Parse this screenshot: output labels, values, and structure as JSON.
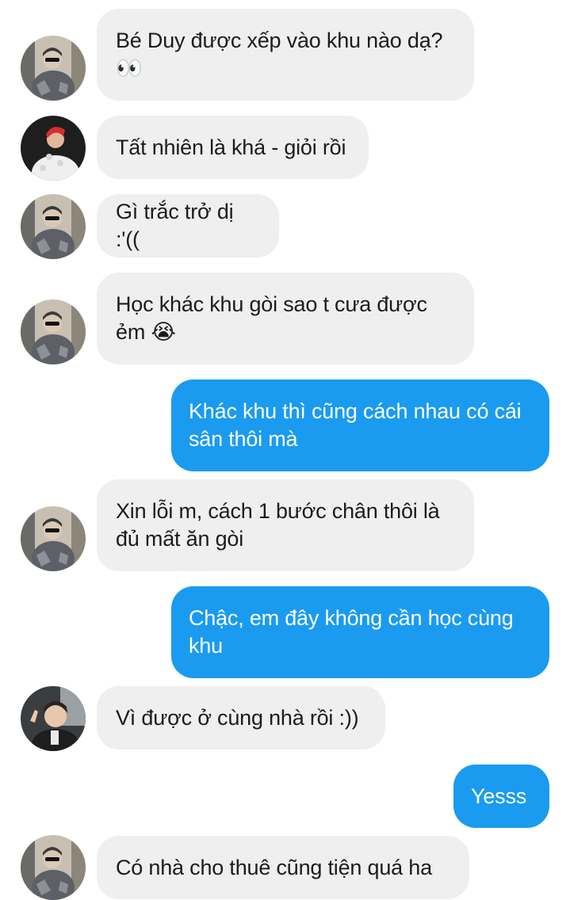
{
  "messages": [
    {
      "id": "m1",
      "side": "received",
      "avatar": "friend-a",
      "text": "Bé Duy được xếp vào khu nào dạ? 👀"
    },
    {
      "id": "m2",
      "side": "received",
      "avatar": "friend-b",
      "text": "Tất nhiên là khá - giỏi rồi"
    },
    {
      "id": "m3",
      "side": "received",
      "avatar": "friend-a",
      "text": "Gì trắc trở dị :'(("
    },
    {
      "id": "m4",
      "side": "received",
      "avatar": "friend-a",
      "text": "Học khác khu gòi sao t cưa được ẻm 😭"
    },
    {
      "id": "m5",
      "side": "sent",
      "text": "Khác khu thì cũng cách nhau có cái sân thôi mà"
    },
    {
      "id": "m6",
      "side": "received",
      "avatar": "friend-a",
      "text": "Xin lỗi m, cách 1 bước chân thôi là đủ mất ăn gòi"
    },
    {
      "id": "m7",
      "side": "sent",
      "text": "Chậc, em đây không cần học cùng khu"
    },
    {
      "id": "m8",
      "side": "received",
      "avatar": "friend-c",
      "text": "Vì được ở cùng nhà rồi :))"
    },
    {
      "id": "m9",
      "side": "sent",
      "text": "Yesss"
    },
    {
      "id": "m10",
      "side": "received",
      "avatar": "friend-a",
      "text": "Có nhà cho thuê cũng tiện quá ha"
    }
  ],
  "colors": {
    "sent_bubble": "#1a9bf0",
    "received_bubble": "#efefef",
    "received_text": "#1c1c1c",
    "sent_text": "#ffffff"
  }
}
